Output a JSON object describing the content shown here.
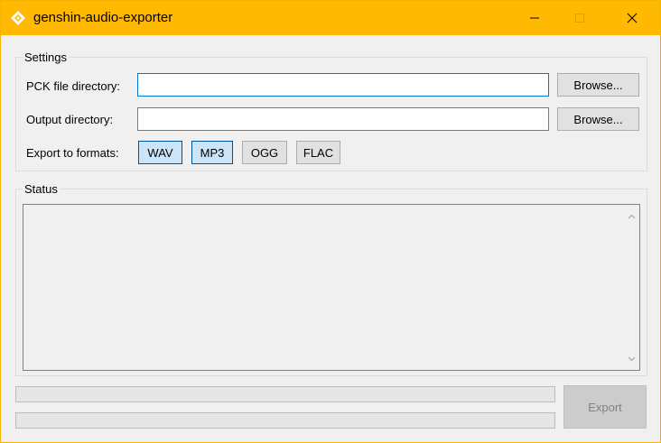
{
  "window": {
    "title": "genshin-audio-exporter",
    "icon": "app-diamond-icon",
    "accent_color": "#ffb900"
  },
  "titlebar_buttons": {
    "minimize_icon": "minimize-icon",
    "maximize_icon": "maximize-icon",
    "close_icon": "close-icon"
  },
  "settings": {
    "group_title": "Settings",
    "pck_label": "PCK file directory:",
    "pck_value": "",
    "output_label": "Output directory:",
    "output_value": "",
    "browse_label": "Browse...",
    "formats_label": "Export to formats:",
    "formats": [
      {
        "label": "WAV",
        "selected": true
      },
      {
        "label": "MP3",
        "selected": true
      },
      {
        "label": "OGG",
        "selected": false
      },
      {
        "label": "FLAC",
        "selected": false
      }
    ]
  },
  "status": {
    "group_title": "Status",
    "log_text": ""
  },
  "progress": {
    "bar1": 0,
    "bar2": 0
  },
  "export": {
    "label": "Export",
    "enabled": false
  }
}
